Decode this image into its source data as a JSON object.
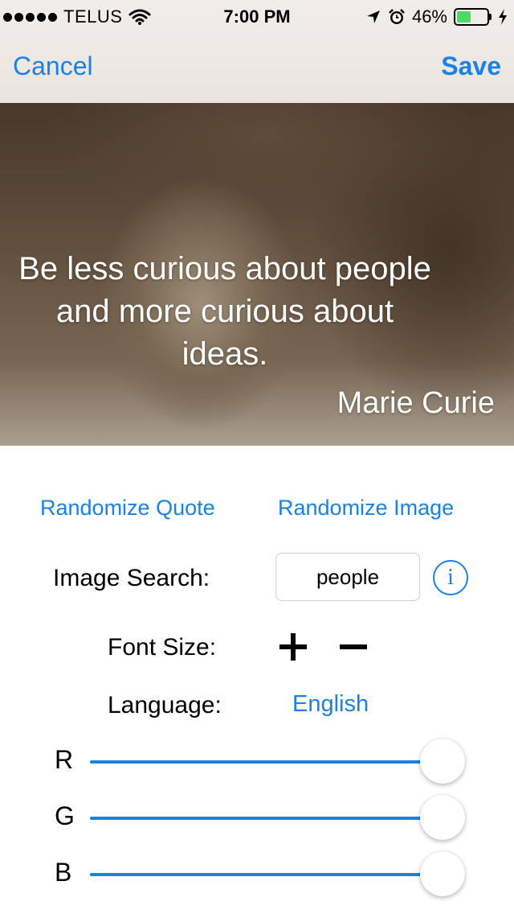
{
  "status_bar": {
    "carrier": "TELUS",
    "time": "7:00 PM",
    "battery_percent": "46%",
    "battery_level": 0.46,
    "battery_color": "#4cd964"
  },
  "nav": {
    "cancel_label": "Cancel",
    "save_label": "Save",
    "accent_color": "#1a82e2"
  },
  "quote": {
    "text": "Be less curious about people and more curious about ideas.",
    "author": "Marie Curie"
  },
  "actions": {
    "randomize_quote_label": "Randomize Quote",
    "randomize_image_label": "Randomize Image"
  },
  "image_search": {
    "label": "Image Search:",
    "value": "people"
  },
  "font_size": {
    "label": "Font Size:"
  },
  "language": {
    "label": "Language:",
    "value": "English"
  },
  "sliders": [
    {
      "label": "R",
      "value": 1.0
    },
    {
      "label": "G",
      "value": 1.0
    },
    {
      "label": "B",
      "value": 1.0
    }
  ],
  "icons": [
    "signal-dots-icon",
    "wifi-icon",
    "location-arrow-icon",
    "alarm-icon",
    "battery-icon",
    "charging-bolt-icon",
    "info-icon",
    "plus-icon",
    "minus-icon"
  ]
}
